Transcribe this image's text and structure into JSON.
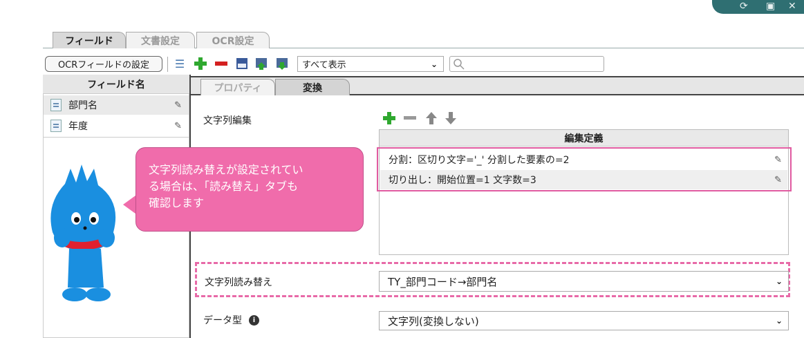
{
  "tabs": [
    "フィールド",
    "文書設定",
    "OCR設定"
  ],
  "toolbar": {
    "ocr_button": "OCRフィールドの設定",
    "filter_select": "すべて表示",
    "search_placeholder": ""
  },
  "left": {
    "header": "フィールド名",
    "fields": [
      "部門名",
      "年度"
    ]
  },
  "subtabs": [
    "プロパティ",
    "変換"
  ],
  "edit": {
    "label": "文字列編集",
    "table_header": "編集定義",
    "rows": [
      "分割：区切り文字='_' 分割した要素の=2",
      "切り出し：開始位置=1 文字数=3"
    ]
  },
  "replace": {
    "label": "文字列読み替え",
    "value": "TY_部門コード→部門名"
  },
  "datatype": {
    "label": "データ型",
    "value": "文字列(変換しない)"
  },
  "bubble": {
    "lines": [
      "文字列読み替えが設定されてい",
      "る場合は、「読み替え」タブも",
      "確認します"
    ]
  },
  "colors": {
    "accent_pink": "#e05aa0",
    "bubble": "#f06cab",
    "teal": "#2f6f72",
    "mascot": "#1a8fe0"
  }
}
